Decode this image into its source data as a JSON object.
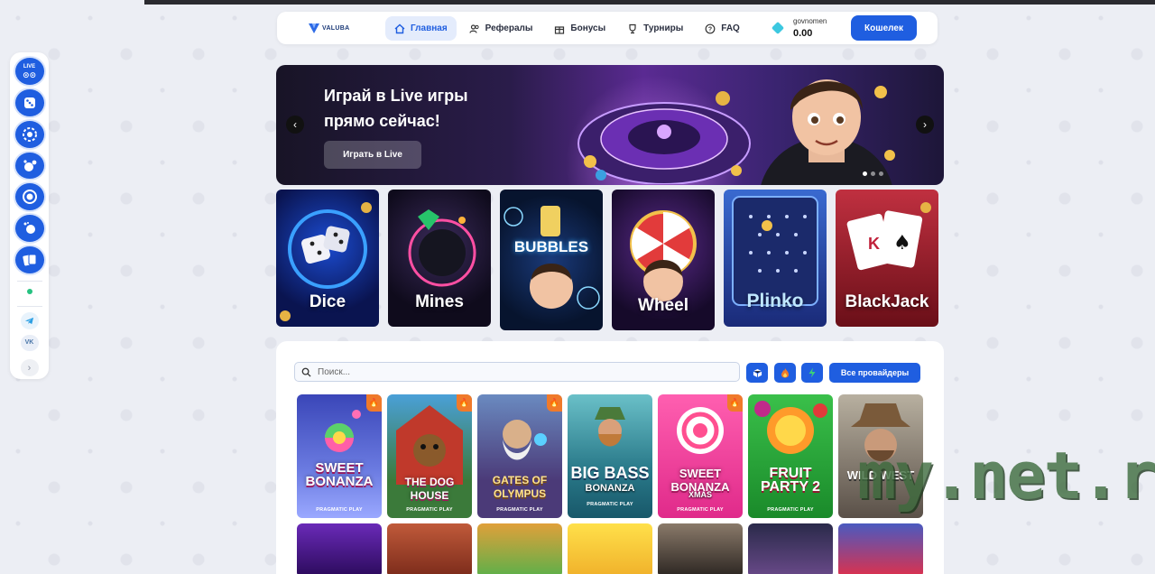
{
  "header": {
    "logo_text": "VALUBA",
    "nav": [
      {
        "label": "Главная",
        "icon": "home-icon",
        "active": true
      },
      {
        "label": "Рефералы",
        "icon": "users-icon",
        "active": false
      },
      {
        "label": "Бонусы",
        "icon": "gift-icon",
        "active": false
      },
      {
        "label": "Турниры",
        "icon": "trophy-icon",
        "active": false
      },
      {
        "label": "FAQ",
        "icon": "help-icon",
        "active": false
      }
    ],
    "username": "govnomen",
    "balance": "0.00",
    "wallet_label": "Кошелек"
  },
  "sidebar": {
    "live_label": "LIVE",
    "items": [
      "live-games-icon",
      "dice-icon",
      "gear-icon",
      "bubbles-icon",
      "target-icon",
      "comet-icon",
      "cards-icon"
    ],
    "status": "online",
    "social": [
      "telegram-icon",
      "vk-icon"
    ],
    "vk_label": "VK",
    "more_label": "›"
  },
  "banner": {
    "title": "Играй в Live игры прямо сейчас!",
    "button_label": "Играть в Live",
    "prev_label": "‹",
    "next_label": "›"
  },
  "tiles": [
    {
      "label": "Dice"
    },
    {
      "label": "Mines"
    },
    {
      "label": "Wheel",
      "top_label": "BUBBLES"
    },
    {
      "label": "Wheel"
    },
    {
      "label": "Plinko"
    },
    {
      "label": "BlackJack"
    }
  ],
  "games": {
    "search_placeholder": "Поиск...",
    "providers_label": "Все провайдеры",
    "cards": [
      {
        "title": "SWEET BONANZA",
        "subtitle": "",
        "provider": "PRAGMATIC PLAY",
        "hot": true
      },
      {
        "title": "THE DOG HOUSE",
        "subtitle": "",
        "provider": "PRAGMATIC PLAY",
        "hot": true
      },
      {
        "title": "GATES OF OLYMPUS",
        "subtitle": "",
        "provider": "PRAGMATIC PLAY",
        "hot": true
      },
      {
        "title": "BIG BASS",
        "subtitle": "BONANZA",
        "provider": "PRAGMATIC PLAY",
        "hot": false
      },
      {
        "title": "SWEET BONANZA",
        "subtitle": "XMAS",
        "provider": "PRAGMATIC PLAY",
        "hot": true
      },
      {
        "title": "FRUIT PARTY 2",
        "subtitle": "",
        "provider": "PRAGMATIC PLAY",
        "hot": false
      },
      {
        "title": "WILD WEST",
        "subtitle": "",
        "provider": "",
        "hot": false
      }
    ]
  },
  "watermark": "my.net.ru",
  "colors": {
    "accent": "#1f5ee0",
    "hot": "#f07a2a",
    "background": "#eceef4"
  }
}
